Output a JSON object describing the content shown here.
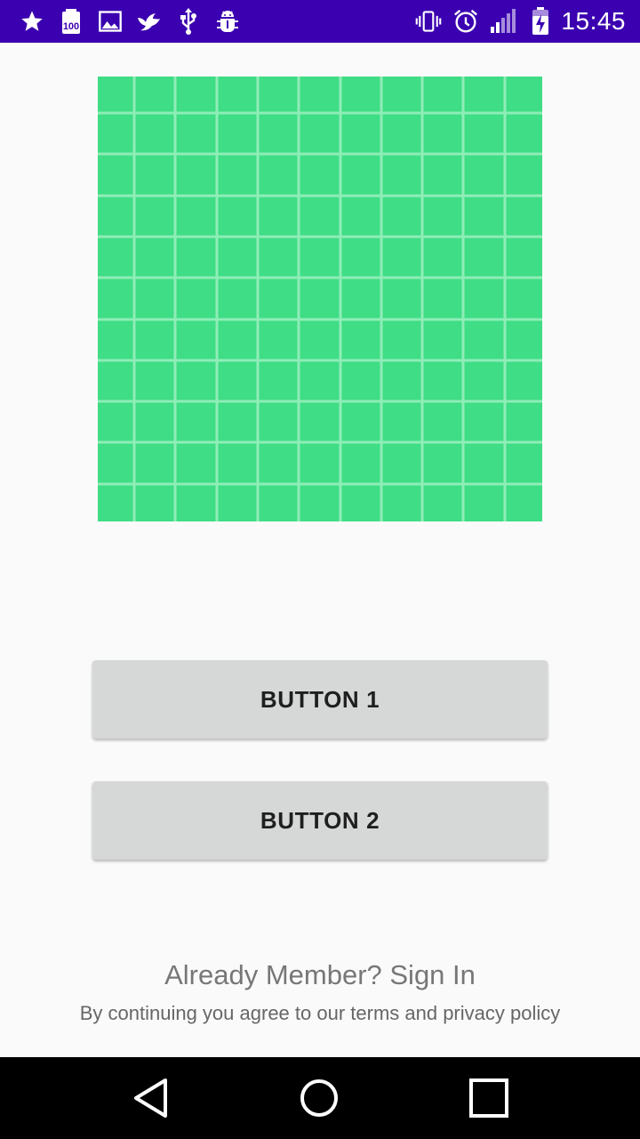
{
  "status_bar": {
    "time": "15:45",
    "left_icons": [
      "star-icon",
      "battery-100-icon",
      "image-icon",
      "bird-icon",
      "usb-icon",
      "android-debug-icon"
    ],
    "right_icons": [
      "vibrate-icon",
      "alarm-icon",
      "signal-icon",
      "battery-charging-icon"
    ],
    "background": "#3b00b0"
  },
  "hero": {
    "icon": "grid-pattern-image",
    "color": "#3fdd85"
  },
  "buttons": {
    "button1_label": "BUTTON 1",
    "button2_label": "BUTTON 2"
  },
  "footer": {
    "signin_text": "Already Member? Sign In",
    "terms_text": "By continuing you agree to our terms and privacy policy"
  },
  "nav_bar": {
    "icons": [
      "back-icon",
      "home-icon",
      "recent-apps-icon"
    ]
  }
}
